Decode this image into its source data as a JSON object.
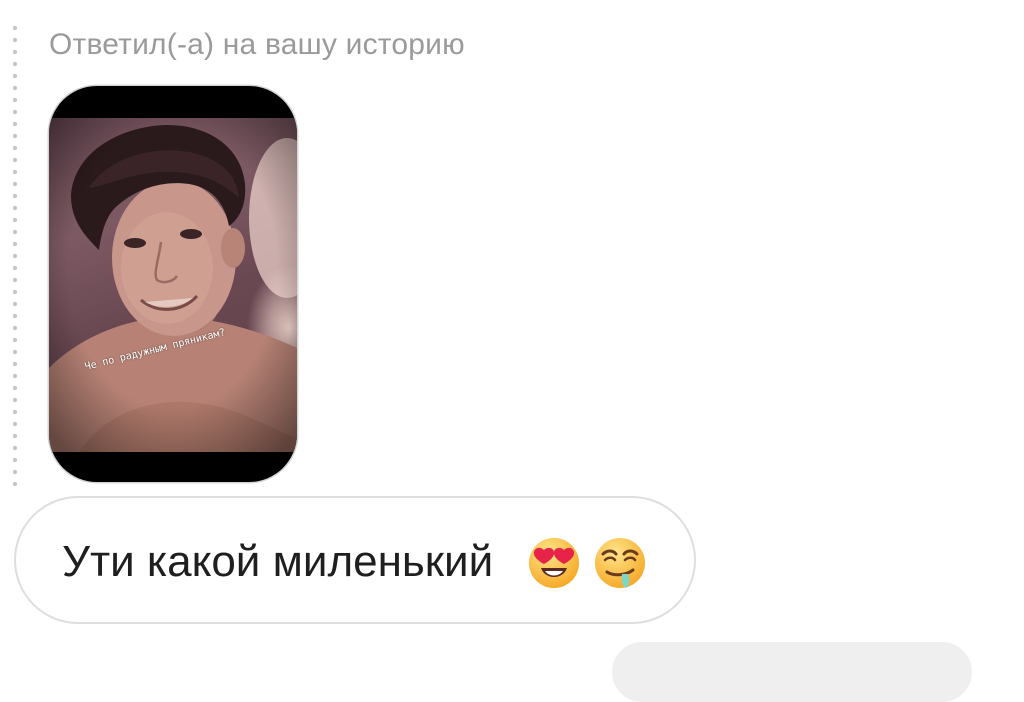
{
  "thread": {
    "reply_caption": "Ответил(-а) на вашу историю",
    "line_color": "#c6c6c6"
  },
  "story": {
    "sticker_text": "Че по радужным пряникам?",
    "thumbnail_description": "selfie"
  },
  "message": {
    "text": "Ути какой миленький",
    "emojis": [
      "heart-eyes-emoji",
      "drooling-face-emoji"
    ],
    "bubble_border": "#dedede",
    "text_color": "#1f1f1f"
  },
  "colors": {
    "caption_gray": "#9a9a9a",
    "background": "#ffffff",
    "next_bubble": "#efefef"
  }
}
